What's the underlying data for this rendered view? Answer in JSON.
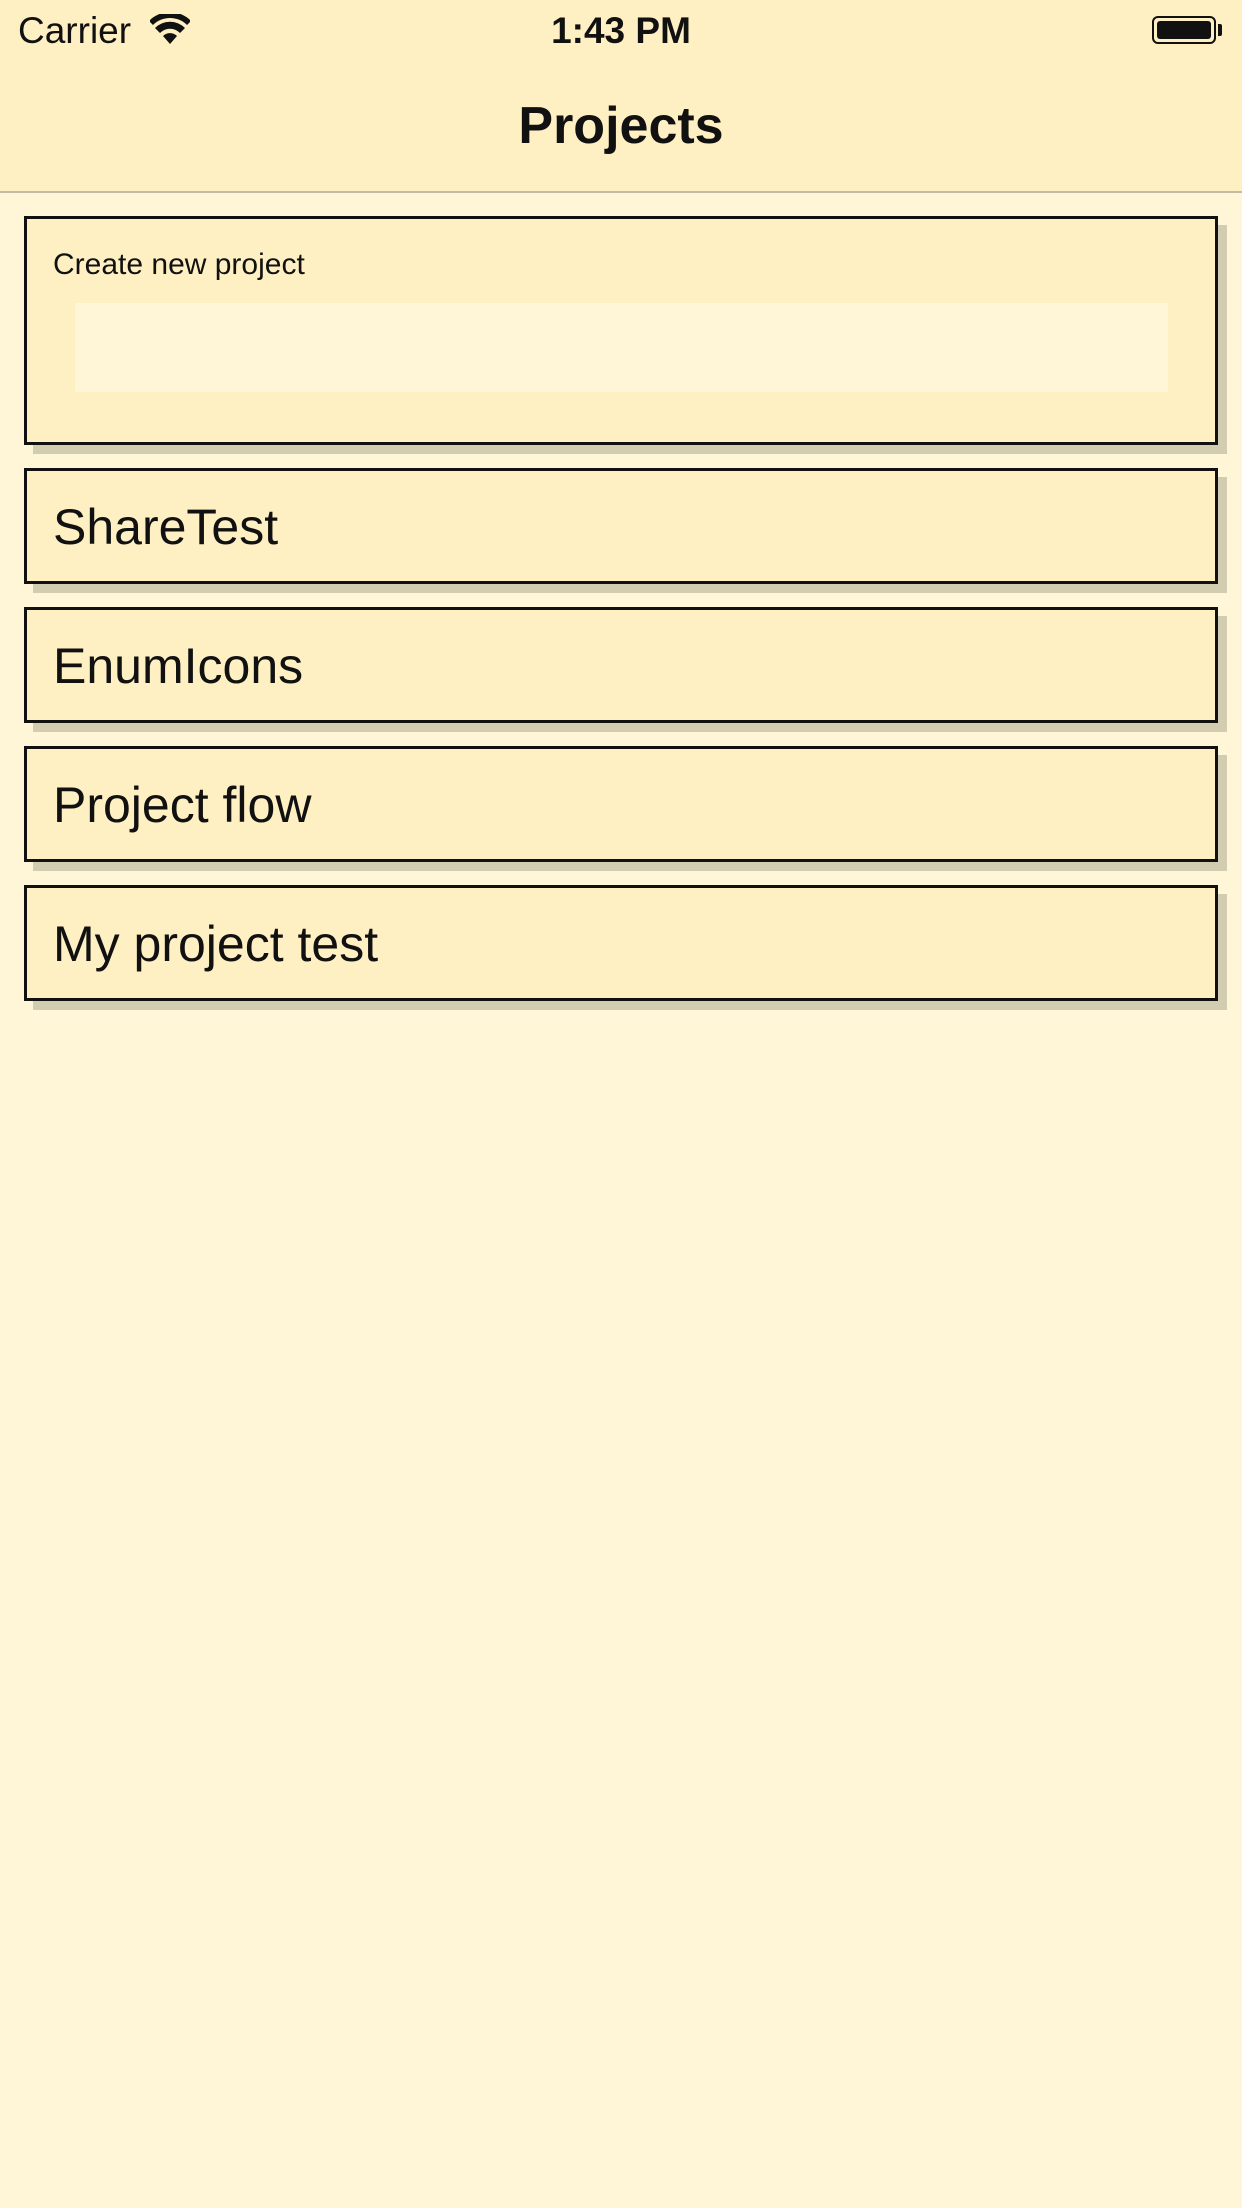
{
  "status_bar": {
    "carrier": "Carrier",
    "time": "1:43 PM"
  },
  "nav": {
    "title": "Projects"
  },
  "create_project": {
    "label": "Create new project",
    "value": "",
    "placeholder": ""
  },
  "projects": [
    {
      "name": "ShareTest"
    },
    {
      "name": "EnumIcons"
    },
    {
      "name": "Project flow"
    },
    {
      "name": "My project test"
    }
  ],
  "colors": {
    "background": "#fff6d8",
    "card": "#fef0c2",
    "card_border": "#111111",
    "card_shadow": "#d2ccb0"
  }
}
